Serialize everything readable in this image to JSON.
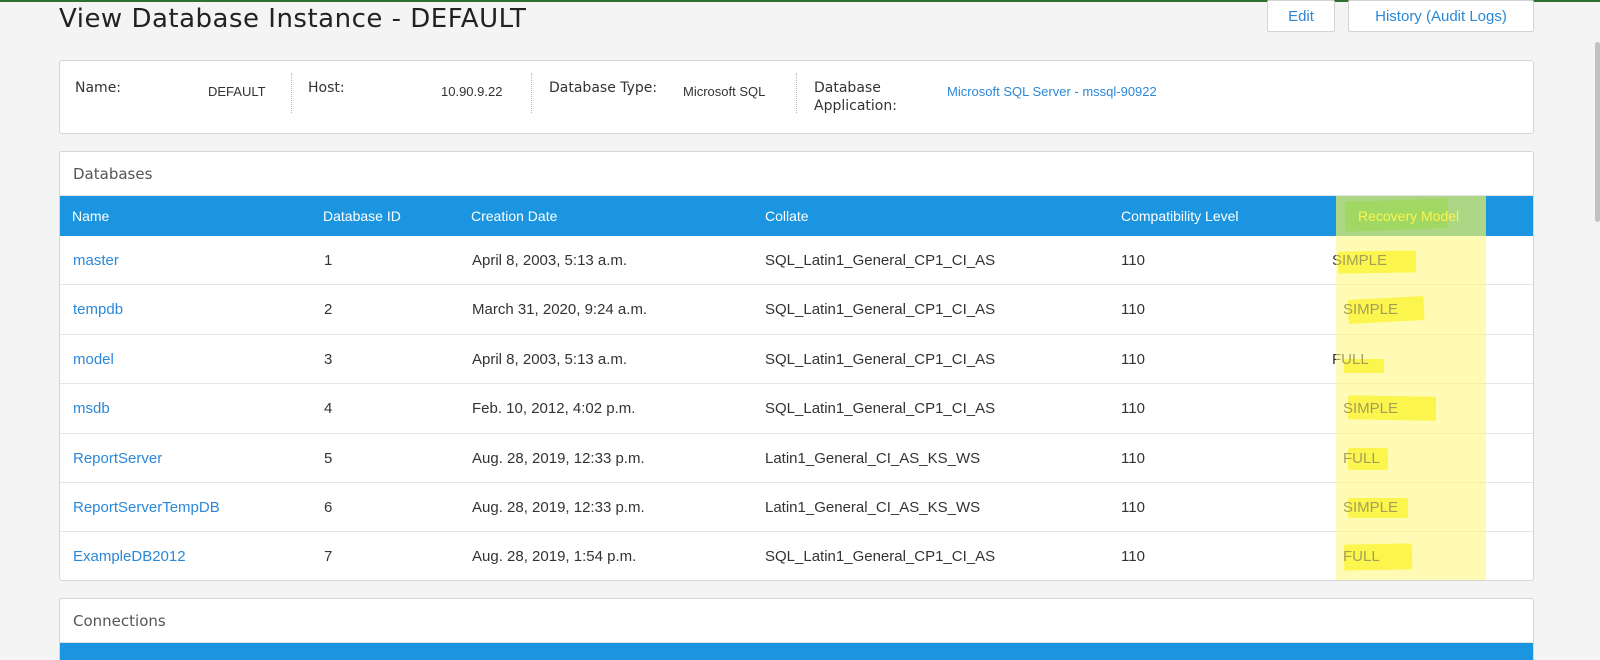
{
  "page": {
    "title": "View Database Instance - DEFAULT",
    "edit_label": "Edit",
    "audit_label": "History (Audit Logs)"
  },
  "info": {
    "name_label": "Name:",
    "name_value": "DEFAULT",
    "host_label": "Host:",
    "host_value": "10.90.9.22",
    "type_label": "Database Type:",
    "type_value": "Microsoft SQL",
    "app_label_1": "Database",
    "app_label_2": "Application:",
    "app_value": "Microsoft SQL Server - mssql-90922"
  },
  "databases": {
    "title": "Databases",
    "columns": [
      "Name",
      "Database ID",
      "Creation Date",
      "Collate",
      "Compatibility Level",
      "Recovery Model"
    ],
    "rows": [
      {
        "name": "master",
        "id": "1",
        "created": "April 8, 2003, 5:13 a.m.",
        "collate": "SQL_Latin1_General_CP1_CI_AS",
        "compat": "110",
        "recovery": "SIMPLE"
      },
      {
        "name": "tempdb",
        "id": "2",
        "created": "March 31, 2020, 9:24 a.m.",
        "collate": "SQL_Latin1_General_CP1_CI_AS",
        "compat": "110",
        "recovery": "SIMPLE"
      },
      {
        "name": "model",
        "id": "3",
        "created": "April 8, 2003, 5:13 a.m.",
        "collate": "SQL_Latin1_General_CP1_CI_AS",
        "compat": "110",
        "recovery": "FULL"
      },
      {
        "name": "msdb",
        "id": "4",
        "created": "Feb. 10, 2012, 4:02 p.m.",
        "collate": "SQL_Latin1_General_CP1_CI_AS",
        "compat": "110",
        "recovery": "SIMPLE"
      },
      {
        "name": "ReportServer",
        "id": "5",
        "created": "Aug. 28, 2019, 12:33 p.m.",
        "collate": "Latin1_General_CI_AS_KS_WS",
        "compat": "110",
        "recovery": "FULL"
      },
      {
        "name": "ReportServerTempDB",
        "id": "6",
        "created": "Aug. 28, 2019, 12:33 p.m.",
        "collate": "Latin1_General_CI_AS_KS_WS",
        "compat": "110",
        "recovery": "SIMPLE"
      },
      {
        "name": "ExampleDB2012",
        "id": "7",
        "created": "Aug. 28, 2019, 1:54 p.m.",
        "collate": "SQL_Latin1_General_CP1_CI_AS",
        "compat": "110",
        "recovery": "FULL"
      }
    ]
  },
  "connections": {
    "title": "Connections"
  },
  "colors": {
    "header_blue": "#1b95e0",
    "link_blue": "#2b88d8",
    "highlight_yellow": "#f7f21a",
    "highlight_green": "#2db14a"
  }
}
